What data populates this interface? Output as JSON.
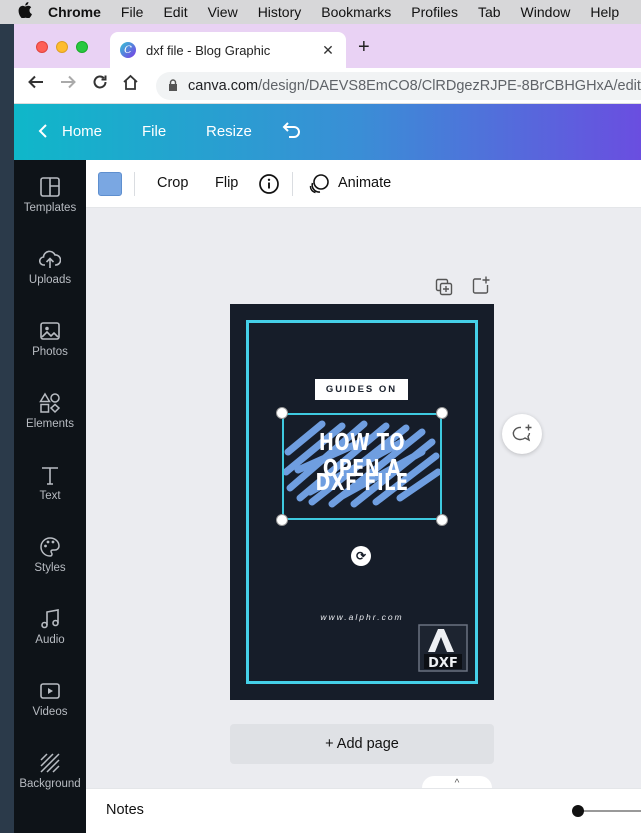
{
  "menubar": {
    "app": "Chrome",
    "items": [
      "File",
      "Edit",
      "View",
      "History",
      "Bookmarks",
      "Profiles",
      "Tab",
      "Window",
      "Help"
    ]
  },
  "browser": {
    "tab_title": "dxf file - Blog Graphic",
    "favicon_letter": "C",
    "url_host": "canva.com",
    "url_path": "/design/DAEVS8EmCO8/ClRDgezRJPE-8BrCBHGHxA/edit-"
  },
  "header": {
    "home": "Home",
    "file": "File",
    "resize": "Resize"
  },
  "sidebar": {
    "items": [
      {
        "label": "Templates",
        "icon": "templates-icon"
      },
      {
        "label": "Uploads",
        "icon": "uploads-icon"
      },
      {
        "label": "Photos",
        "icon": "photos-icon"
      },
      {
        "label": "Elements",
        "icon": "elements-icon"
      },
      {
        "label": "Text",
        "icon": "text-icon"
      },
      {
        "label": "Styles",
        "icon": "styles-icon"
      },
      {
        "label": "Audio",
        "icon": "audio-icon"
      },
      {
        "label": "Videos",
        "icon": "videos-icon"
      },
      {
        "label": "Background",
        "icon": "background-icon"
      }
    ]
  },
  "toolbar": {
    "swatch_color": "#7aa7e2",
    "crop": "Crop",
    "flip": "Flip",
    "animate": "Animate"
  },
  "design": {
    "badge": "GUIDES ON",
    "headline_line1": "HOW TO OPEN A",
    "headline_line2": "DXF FILE",
    "website": "www.alphr.com",
    "logo_text": "DXF",
    "frame_color": "#45d0e8",
    "background_color": "#161d29"
  },
  "canvas": {
    "add_page": "+ Add page"
  },
  "footer": {
    "notes": "Notes"
  }
}
